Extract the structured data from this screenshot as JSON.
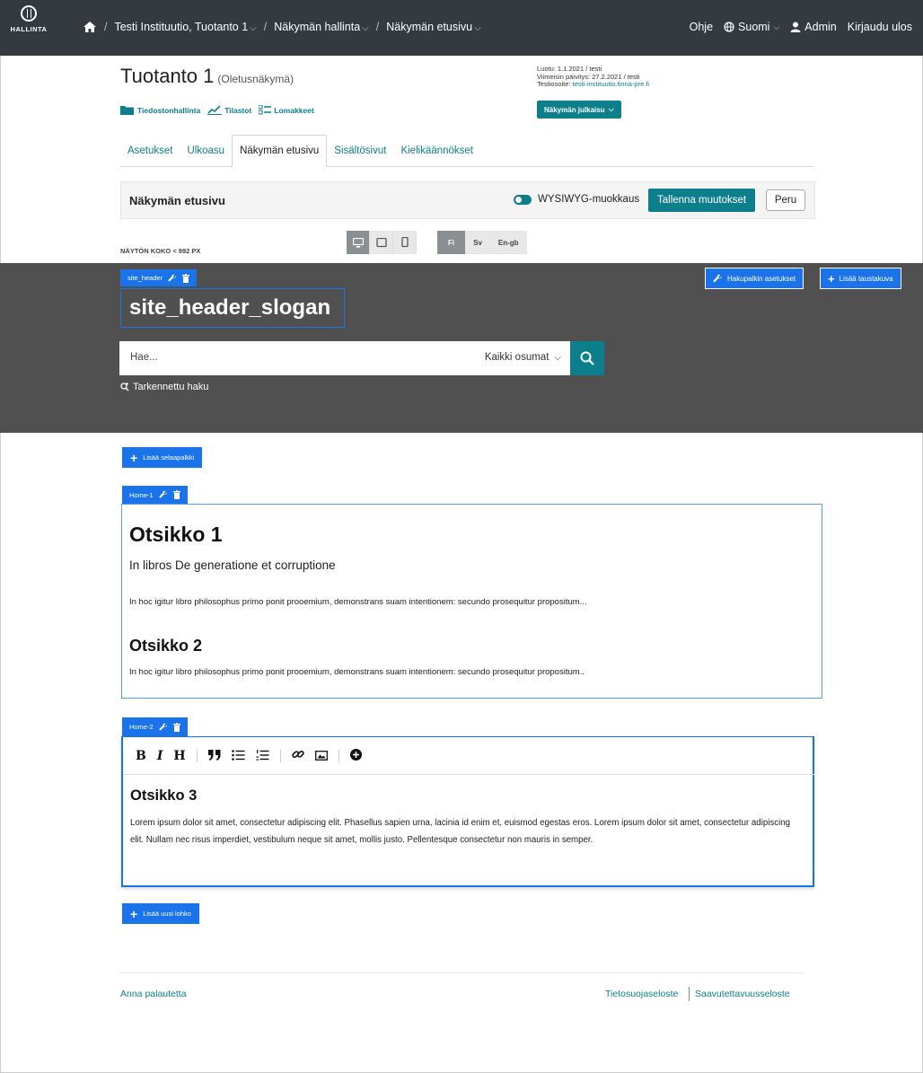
{
  "nav": {
    "logo_text": "HALLINTA",
    "crumbs": [
      "Testi Instituutio, Tuotanto 1",
      "Näkymän hallinta",
      "Näkymän etusivu"
    ],
    "help": "Ohje",
    "language": "Suomi",
    "user": "Admin",
    "logout": "Kirjaudu ulos"
  },
  "header": {
    "title": "Tuotanto 1",
    "subtitle": "(Oletusnäkymä)",
    "quicklinks": [
      "Tiedostonhallinta",
      "Tilastot",
      "Lomakkeet"
    ],
    "meta": {
      "created": "Luotu: 1.1.2021 / testi",
      "updated": "Viimeisin päivitys: 27.2.2021 / testi",
      "test_label": "Testiosoite:",
      "test_url": "testi-instituutio.finna-pre.fi"
    },
    "publish_label": "Näkymän julkaisu"
  },
  "tabs": [
    "Asetukset",
    "Ulkoasu",
    "Näkymän etusivu",
    "Sisältösivut",
    "Kielikäännökset"
  ],
  "editbar": {
    "heading": "Näkymän etusivu",
    "wysiwyg_label": "WYSIWYG-muokkaus",
    "save_label": "Tallenna muutokset",
    "cancel_label": "Peru"
  },
  "viewport": {
    "size_label": "NÄYTÖN KOKO < 992 PX",
    "languages": [
      "Fi",
      "Sv",
      "En-gb"
    ]
  },
  "site_header": {
    "tag": "site_header",
    "search_settings_label": "Hakupalkin asetukset",
    "add_background_label": "Lisää taustakuva",
    "slogan": "site_header_slogan",
    "search_placeholder": "Hae...",
    "search_scope": "Kaikki osumat",
    "advanced_search": "Tarkennettu haku"
  },
  "content": {
    "add_browse_bar": "Lisää selaapalkki",
    "block1": {
      "tag": "Home-1",
      "heading1": "Otsikko 1",
      "subheading": "In libros De generatione et corruptione",
      "paragraph1": "In hoc igitur libro philosophus primo ponit prooemium, demonstrans suam intentionem: secundo prosequitur propositum...",
      "heading2": "Otsikko 2",
      "paragraph2": "In hoc igitur libro philosophus primo ponit prooemium, demonstrans suam intentionem: secundo prosequitur propositum.."
    },
    "block2": {
      "tag": "Home-2",
      "toolbar": [
        "B",
        "I",
        "H"
      ],
      "heading3": "Otsikko 3",
      "paragraph": "Lorem ipsum dolor sit amet, consectetur adipiscing elit. Phasellus sapien urna, lacinia id enim et, euismod egestas eros. Lorem ipsum dolor sit amet, consectetur adipiscing elit. Nullam nec risus imperdiet, vestibulum neque sit amet, mollis justo. Pellentesque consectetur non mauris in semper."
    },
    "add_block": "Lisää uusi lohko"
  },
  "footer": {
    "feedback": "Anna palautetta",
    "privacy": "Tietosuojaseloste",
    "accessibility": "Saavutettavuusseloste"
  },
  "colors": {
    "teal": "#0d7f8c",
    "blue": "#1a73e8",
    "dark": "#343a40",
    "site_bg": "#505050"
  }
}
